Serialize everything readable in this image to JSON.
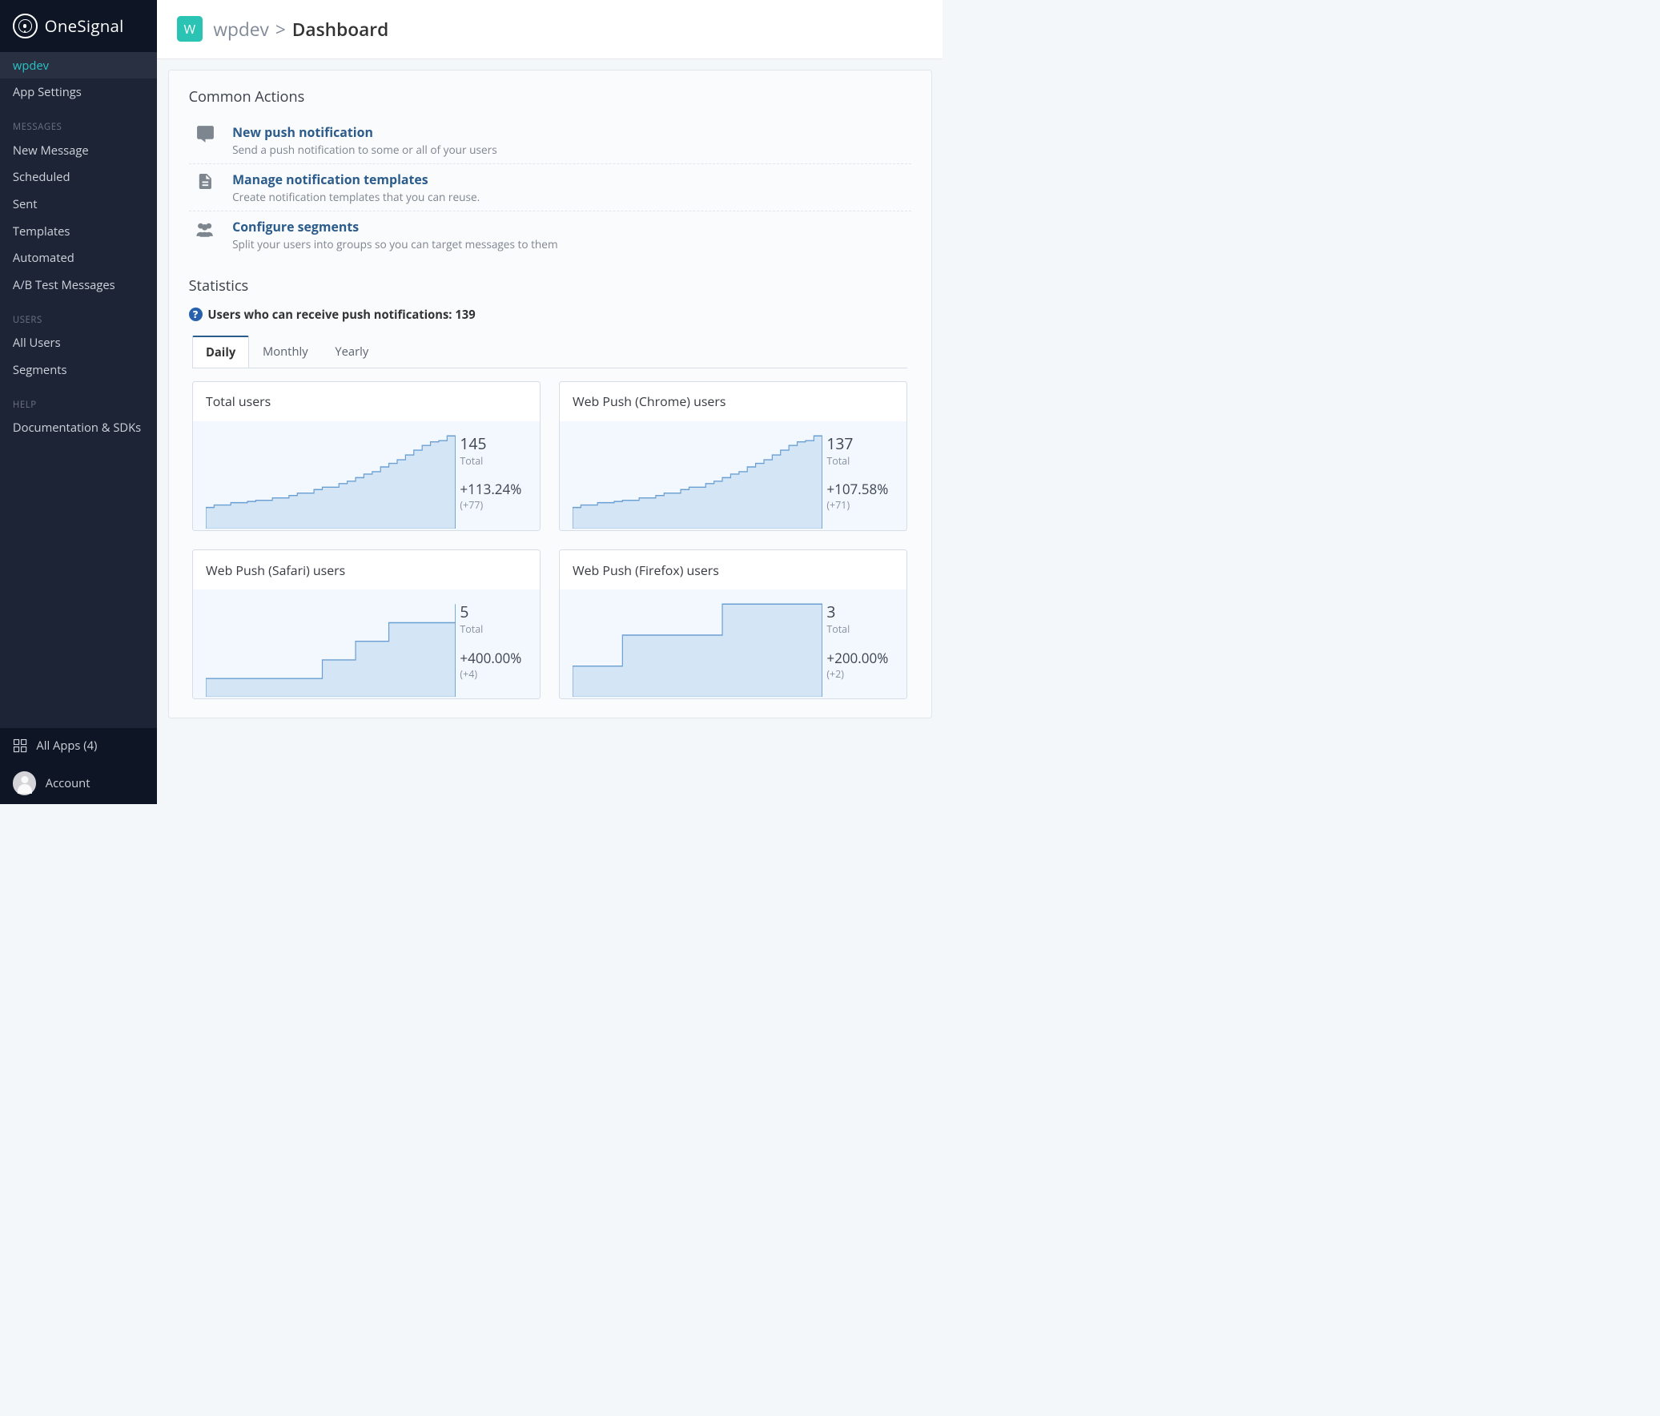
{
  "brand": "OneSignal",
  "sidebar": {
    "top": [
      {
        "label": "wpdev",
        "active": true
      },
      {
        "label": "App Settings"
      }
    ],
    "groups": [
      {
        "header": "MESSAGES",
        "items": [
          {
            "label": "New Message"
          },
          {
            "label": "Scheduled"
          },
          {
            "label": "Sent"
          },
          {
            "label": "Templates"
          },
          {
            "label": "Automated"
          },
          {
            "label": "A/B Test Messages"
          }
        ]
      },
      {
        "header": "USERS",
        "items": [
          {
            "label": "All Users"
          },
          {
            "label": "Segments"
          }
        ]
      },
      {
        "header": "HELP",
        "items": [
          {
            "label": "Documentation & SDKs"
          }
        ]
      }
    ],
    "footer": {
      "all_apps": "All Apps (4)",
      "account": "Account"
    }
  },
  "breadcrumb": {
    "badge": "W",
    "app": "wpdev",
    "sep": ">",
    "current": "Dashboard"
  },
  "common_actions": {
    "title": "Common Actions",
    "items": [
      {
        "icon": "comment",
        "title": "New push notification",
        "sub": "Send a push notification to some or all of your users"
      },
      {
        "icon": "file",
        "title": "Manage notification templates",
        "sub": "Create notification templates that you can reuse."
      },
      {
        "icon": "users",
        "title": "Configure segments",
        "sub": "Split your users into groups so you can target messages to them"
      }
    ]
  },
  "statistics": {
    "title": "Statistics",
    "note": "Users who can receive push notifications: 139",
    "tabs": [
      {
        "label": "Daily",
        "active": true
      },
      {
        "label": "Monthly"
      },
      {
        "label": "Yearly"
      }
    ],
    "cards": [
      {
        "title": "Total users",
        "total": "145",
        "total_label": "Total",
        "pct": "+113.24%",
        "delta": "(+77)",
        "chart_key": "growth"
      },
      {
        "title": "Web Push (Chrome) users",
        "total": "137",
        "total_label": "Total",
        "pct": "+107.58%",
        "delta": "(+71)",
        "chart_key": "growth"
      },
      {
        "title": "Web Push (Safari) users",
        "total": "5",
        "total_label": "Total",
        "pct": "+400.00%",
        "delta": "(+4)",
        "chart_key": "steps_safari"
      },
      {
        "title": "Web Push (Firefox) users",
        "total": "3",
        "total_label": "Total",
        "pct": "+200.00%",
        "delta": "(+2)",
        "chart_key": "steps_firefox"
      }
    ]
  },
  "chart_data": {
    "type": "area",
    "note": "Sparkline mini-charts; numeric axes not labeled in source image. Values are relative step heights over ~30 daily samples.",
    "series": {
      "growth": [
        18,
        20,
        20,
        22,
        22,
        23,
        24,
        24,
        26,
        26,
        28,
        30,
        30,
        33,
        35,
        35,
        38,
        40,
        43,
        46,
        48,
        52,
        55,
        58,
        62,
        66,
        70,
        73,
        74,
        78,
        78
      ],
      "steps_safari": [
        1,
        1,
        1,
        1,
        1,
        1,
        1,
        1,
        1,
        1,
        1,
        1,
        1,
        1,
        2,
        2,
        2,
        2,
        3,
        3,
        3,
        3,
        4,
        4,
        4,
        4,
        4,
        4,
        4,
        4,
        5
      ],
      "steps_firefox": [
        1,
        1,
        1,
        1,
        1,
        1,
        2,
        2,
        2,
        2,
        2,
        2,
        2,
        2,
        2,
        2,
        2,
        2,
        3,
        3,
        3,
        3,
        3,
        3,
        3,
        3,
        3,
        3,
        3,
        3,
        3
      ]
    }
  }
}
